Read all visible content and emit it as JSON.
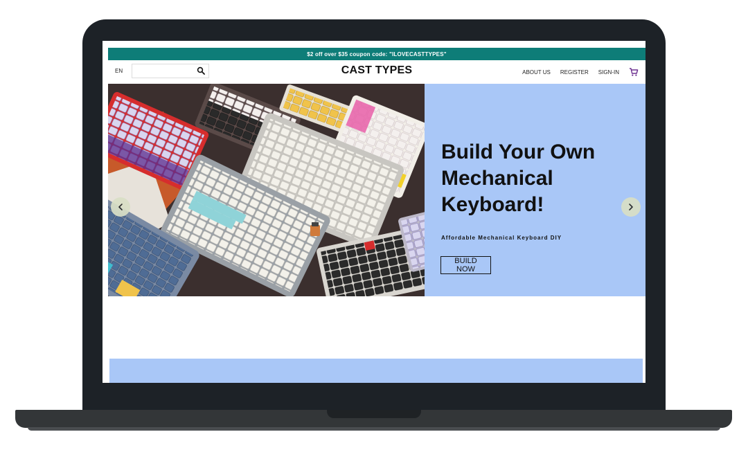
{
  "promo": {
    "text": "$2 off over $35 coupon code: \"ILOVECASTTYPES\""
  },
  "header": {
    "language": "EN",
    "search_placeholder": "",
    "logo": "CAST TYPES",
    "nav": {
      "about": "ABOUT US",
      "register": "REGISTER",
      "signin": "SIGN-IN"
    },
    "cart_icon": "shopping-cart-icon"
  },
  "hero": {
    "title_line1": "Build Your Own",
    "title_line2": "Mechanical",
    "title_line3": "Keyboard!",
    "subtitle": "Affordable Mechanical Keyboard DIY",
    "button_label": "BUILD NOW",
    "prev_icon": "chevron-left-icon",
    "next_icon": "chevron-right-icon",
    "background_color": "#a9c7f7"
  },
  "colors": {
    "promo_bg": "#0e7d78",
    "device_frame": "#1d2227",
    "accent_cart": "#6b2f8f"
  }
}
